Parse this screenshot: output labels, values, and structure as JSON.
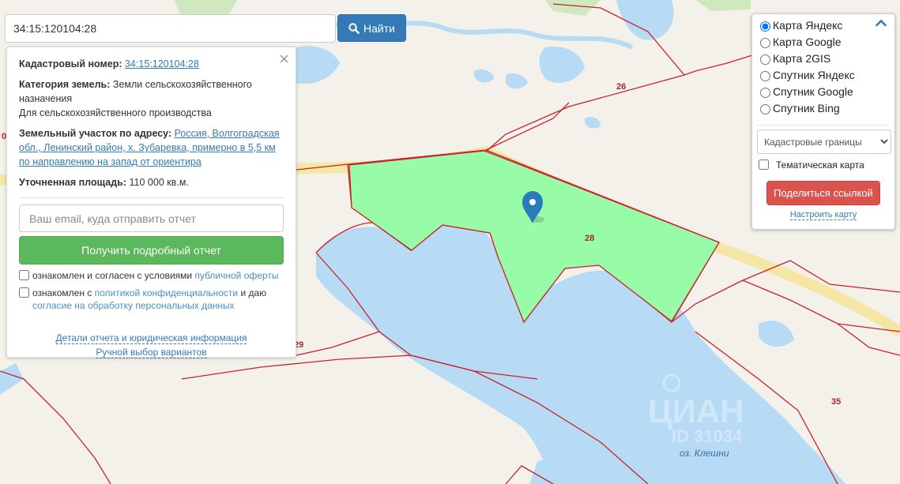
{
  "search": {
    "value": "34:15:120104:28",
    "button_label": "Найти"
  },
  "info": {
    "cadastral_label": "Кадастровый номер:",
    "cadastral_value": "34:15:120104:28",
    "category_label": "Категория земель:",
    "category_value": "Земли сельскохозяйственного назначения",
    "usage_value": "Для сельскохозяйственного производства",
    "address_label": "Земельный участок по адресу:",
    "address_value": "Россия, Волгоградская обл., Ленинский район, х. Зубаревка, примерно в 5,5 км по направлению на запад от ориентира",
    "area_label": "Уточненная площадь:",
    "area_value": "110 000 кв.м.",
    "email_placeholder": "Ваш email, куда отправить отчет",
    "report_button": "Получить подробный отчет",
    "offer_text": "ознакомлен и согласен с условиями",
    "offer_link": "публичной оферты",
    "privacy_text": "ознакомлен с",
    "privacy_link": "политикой конфиденциальности",
    "privacy_text2": "и даю",
    "consent_link": "согласие на обработку персональных данных",
    "details_link": "Детали отчета и юридическая информация",
    "manual_link": "Ручной выбор вариантов",
    "close_symbol": "×"
  },
  "layers": {
    "options": [
      {
        "label": "Карта Яндекс",
        "checked": true
      },
      {
        "label": "Карта Google",
        "checked": false
      },
      {
        "label": "Карта 2GIS",
        "checked": false
      },
      {
        "label": "Спутник Яндекс",
        "checked": false
      },
      {
        "label": "Спутник Google",
        "checked": false
      },
      {
        "label": "Спутник Bing",
        "checked": false
      }
    ],
    "select_value": "Кадастровые границы",
    "thematic_label": "Тематическая карта",
    "share_button": "Поделиться ссылкой",
    "configure_link": "Настроить карту"
  },
  "map": {
    "parcel_labels": [
      "26",
      "28",
      "29",
      "35",
      "0"
    ],
    "lake_label": "оз. Клешни",
    "watermark": "ЦИАН",
    "watermark_id": "ID 31034",
    "colors": {
      "water": "#b7dbf5",
      "land": "#f4f1ea",
      "parcel_fill": "#98fba8",
      "border": "#c9222a",
      "road": "#f5e6a6",
      "marker": "#2a7bbd"
    }
  }
}
